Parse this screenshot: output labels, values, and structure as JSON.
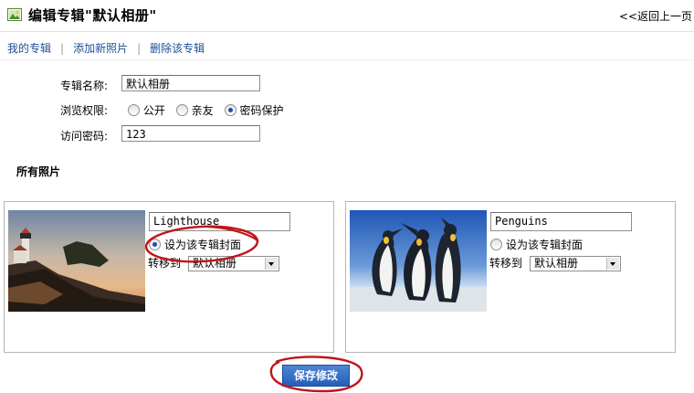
{
  "header": {
    "title": "编辑专辑\"默认相册\"",
    "back": "<<返回上一页"
  },
  "nav": {
    "items": [
      "我的专辑",
      "添加新照片",
      "删除该专辑"
    ]
  },
  "form": {
    "name_label": "专辑名称:",
    "name_value": "默认相册",
    "perm_label": "浏览权限:",
    "perm_options": [
      "公开",
      "亲友",
      "密码保护"
    ],
    "perm_selected": "密码保护",
    "pw_label": "访问密码:",
    "pw_value": "123"
  },
  "section": {
    "title": "所有照片"
  },
  "photos": [
    {
      "caption": "Lighthouse",
      "cover_label": "设为该专辑封面",
      "cover_checked": true,
      "move_label": "转移到",
      "album": "默认相册"
    },
    {
      "caption": "Penguins",
      "cover_label": "设为该专辑封面",
      "cover_checked": false,
      "move_label": "转移到",
      "album": "默认相册"
    }
  ],
  "save": {
    "label": "保存修改"
  },
  "colors": {
    "link": "#1b4f94",
    "button": "#245eb7",
    "highlight": "#c0141b"
  }
}
